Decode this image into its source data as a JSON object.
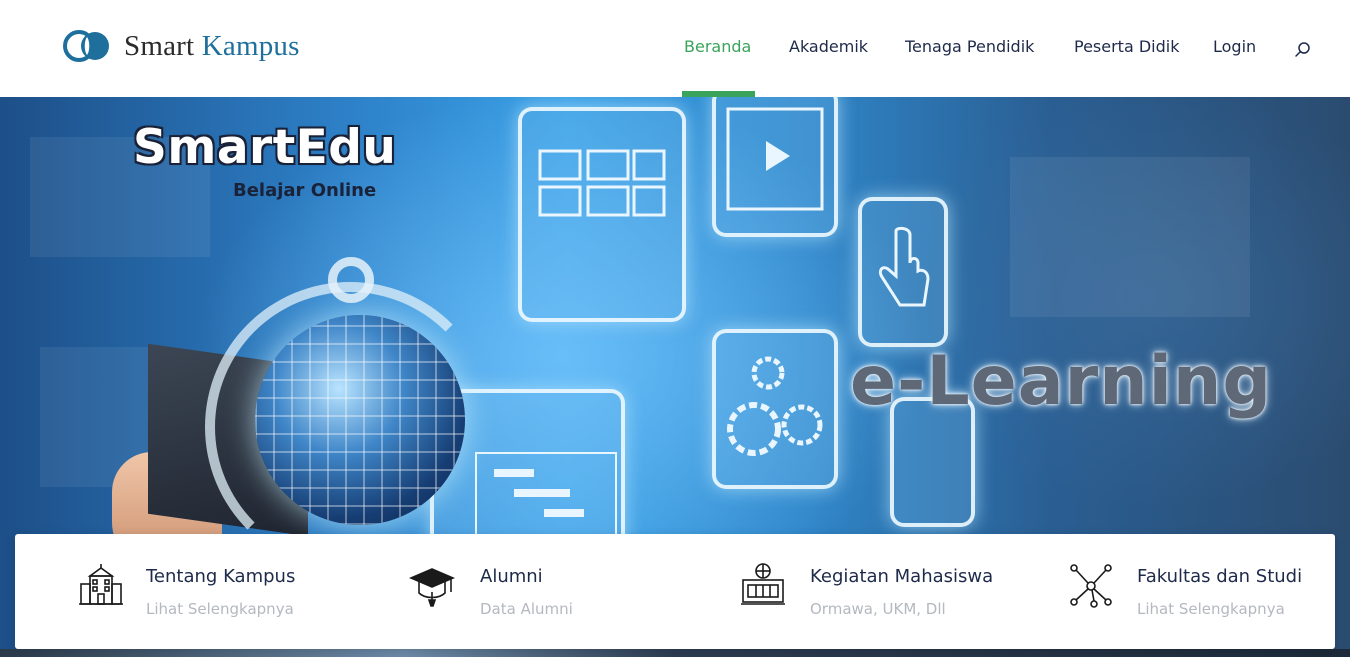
{
  "header": {
    "logo_text_1": "Smart",
    "logo_text_2": "Kampus",
    "nav": [
      {
        "label": "Beranda",
        "active": true
      },
      {
        "label": "Akademik",
        "active": false
      },
      {
        "label": "Tenaga Pendidik",
        "active": false
      },
      {
        "label": "Peserta Didik",
        "active": false
      },
      {
        "label": "Login",
        "active": false
      }
    ],
    "search_icon": "search-icon",
    "active_color": "#3aa35c",
    "text_color": "#1e2a4a"
  },
  "hero": {
    "title": "SmartEdu",
    "subtitle": "Belajar Online",
    "overlay_text": "e-Learning"
  },
  "features": [
    {
      "icon": "school-building-icon",
      "title": "Tentang Kampus",
      "subtitle": "Lihat Selengkapnya"
    },
    {
      "icon": "graduation-cap-icon",
      "title": "Alumni",
      "subtitle": "Data Alumni"
    },
    {
      "icon": "gym-activity-icon",
      "title": "Kegiatan Mahasiswa",
      "subtitle": "Ormawa, UKM, Dll"
    },
    {
      "icon": "network-nodes-icon",
      "title": "Fakultas dan Studi",
      "subtitle": "Lihat Selengkapnya"
    }
  ]
}
